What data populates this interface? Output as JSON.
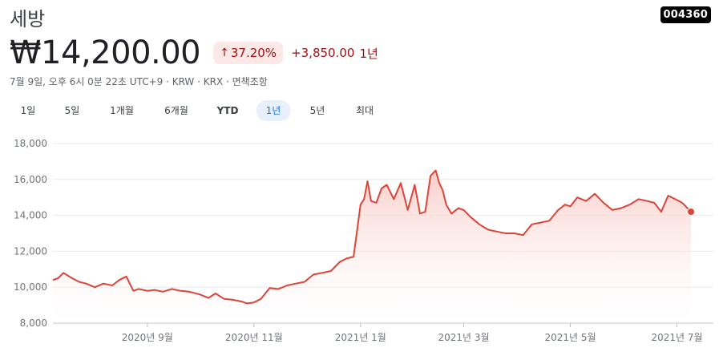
{
  "header": {
    "name": "세방",
    "ticker": "004360",
    "price": "₩14,200.00",
    "change_percent": "37.20%",
    "change_abs": "+3,850.00",
    "change_period": "1년",
    "meta": "7월 9일, 오후 6시 0분 22초 UTC+9 · KRW · KRX · 면책조항"
  },
  "range_tabs": [
    "1일",
    "5일",
    "1개월",
    "6개월",
    "YTD",
    "1년",
    "5년",
    "최대"
  ],
  "active_range": "1년",
  "colors": {
    "line": "#db4437",
    "fill_top": "#f8c9c4",
    "down_text": "#a50e0e",
    "down_bg": "#fce8e6",
    "grid": "#e8eaed",
    "axis_text": "#70757a",
    "active_tab_bg": "#e8f0fe",
    "active_tab_text": "#1a73e8"
  },
  "chart_data": {
    "type": "area",
    "x_tick_labels": [
      "2020년 9월",
      "2020년 11월",
      "2021년 1월",
      "2021년 3월",
      "2021년 5월",
      "2021년 7월"
    ],
    "x_tick_dates": [
      "2020-09-01",
      "2020-11-01",
      "2021-01-01",
      "2021-03-01",
      "2021-05-01",
      "2021-07-01"
    ],
    "y_tick_labels": [
      "8,000",
      "10,000",
      "12,000",
      "14,000",
      "16,000",
      "18,000"
    ],
    "y_ticks": [
      8000,
      10000,
      12000,
      14000,
      16000,
      18000
    ],
    "ylim": [
      8000,
      18000
    ],
    "xlim": [
      "2020-07-09",
      "2021-07-09"
    ],
    "grid": true,
    "series": [
      {
        "x": [
          "2020-07-09",
          "2020-07-12",
          "2020-07-15",
          "2020-07-20",
          "2020-07-24",
          "2020-07-28",
          "2020-08-02",
          "2020-08-07",
          "2020-08-12",
          "2020-08-16",
          "2020-08-20",
          "2020-08-24",
          "2020-08-27",
          "2020-09-01",
          "2020-09-05",
          "2020-09-10",
          "2020-09-15",
          "2020-09-20",
          "2020-09-25",
          "2020-10-01",
          "2020-10-06",
          "2020-10-10",
          "2020-10-15",
          "2020-10-20",
          "2020-10-25",
          "2020-10-28",
          "2020-11-01",
          "2020-11-05",
          "2020-11-10",
          "2020-11-15",
          "2020-11-20",
          "2020-11-25",
          "2020-11-30",
          "2020-12-05",
          "2020-12-10",
          "2020-12-15",
          "2020-12-20",
          "2020-12-24",
          "2020-12-28",
          "2021-01-01",
          "2021-01-03",
          "2021-01-05",
          "2021-01-07",
          "2021-01-10",
          "2021-01-13",
          "2021-01-16",
          "2021-01-20",
          "2021-01-24",
          "2021-01-28",
          "2021-02-01",
          "2021-02-04",
          "2021-02-07",
          "2021-02-10",
          "2021-02-13",
          "2021-02-15",
          "2021-02-17",
          "2021-02-19",
          "2021-02-22",
          "2021-02-26",
          "2021-03-01",
          "2021-03-05",
          "2021-03-10",
          "2021-03-15",
          "2021-03-20",
          "2021-03-25",
          "2021-03-30",
          "2021-04-04",
          "2021-04-09",
          "2021-04-14",
          "2021-04-19",
          "2021-04-24",
          "2021-04-28",
          "2021-05-01",
          "2021-05-05",
          "2021-05-10",
          "2021-05-15",
          "2021-05-20",
          "2021-05-25",
          "2021-05-30",
          "2021-06-04",
          "2021-06-09",
          "2021-06-14",
          "2021-06-18",
          "2021-06-22",
          "2021-06-26",
          "2021-06-30",
          "2021-07-04",
          "2021-07-09"
        ],
        "values": [
          10400,
          10500,
          10800,
          10500,
          10300,
          10200,
          10000,
          10200,
          10100,
          10400,
          10600,
          9800,
          9900,
          9800,
          9850,
          9750,
          9900,
          9800,
          9750,
          9600,
          9400,
          9650,
          9350,
          9300,
          9200,
          9100,
          9150,
          9350,
          9950,
          9900,
          10100,
          10200,
          10300,
          10700,
          10800,
          10900,
          11400,
          11600,
          11700,
          14600,
          14900,
          15900,
          14800,
          14700,
          15500,
          15700,
          14900,
          15800,
          14300,
          15700,
          14100,
          14200,
          16200,
          16500,
          15800,
          15400,
          14600,
          14100,
          14400,
          14300,
          13900,
          13500,
          13200,
          13100,
          13000,
          13000,
          12900,
          13500,
          13600,
          13700,
          14300,
          14600,
          14500,
          15000,
          14800,
          15200,
          14700,
          14300,
          14400,
          14600,
          14900,
          14800,
          14700,
          14200,
          15100,
          14900,
          14700,
          14200
        ]
      }
    ],
    "last_point_marker": true
  }
}
